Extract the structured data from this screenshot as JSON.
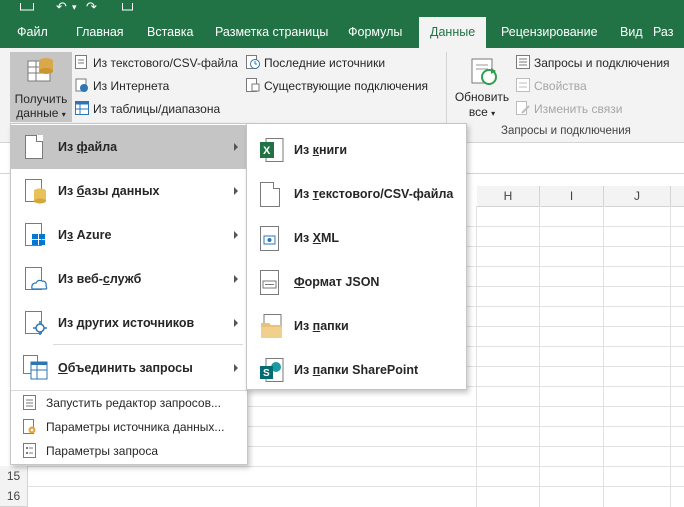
{
  "tabs": [
    "Файл",
    "Главная",
    "Вставка",
    "Разметка страницы",
    "Формулы",
    "Данные",
    "Рецензирование",
    "Вид",
    "Раз"
  ],
  "active_tab": "Данные",
  "ribbon": {
    "get_data_label_1": "Получить",
    "get_data_label_2": "данные",
    "get_group_items": [
      "Из текстового/CSV-файла",
      "Из Интернета",
      "Из таблицы/диапазона"
    ],
    "recent_items": [
      "Последние источники",
      "Существующие подключения"
    ],
    "refresh_label_1": "Обновить",
    "refresh_label_2": "все",
    "queries_items": [
      "Запросы и подключения",
      "Свойства",
      "Изменить связи"
    ],
    "queries_group_label": "Запросы и подключения"
  },
  "menu_main": {
    "items": [
      {
        "pre": "Из ",
        "u": "ф",
        "post": "айла"
      },
      {
        "pre": "Из ",
        "u": "б",
        "post": "азы данных"
      },
      {
        "pre": "И",
        "u": "з",
        "post": " Azure"
      },
      {
        "pre": "Из веб-",
        "u": "с",
        "post": "лужб"
      },
      {
        "pre": "Из ",
        "u": "д",
        "post": "ругих источников"
      },
      {
        "pre": "",
        "u": "О",
        "post": "бъединить запросы"
      }
    ],
    "bottom_items": [
      "Запустить редактор запросов...",
      "Параметры источника данных...",
      "Параметры запроса"
    ]
  },
  "menu_sub": {
    "items": [
      {
        "pre": "Из ",
        "u": "к",
        "post": "ниги"
      },
      {
        "pre": "Из ",
        "u": "т",
        "post": "екстового/CSV-файла"
      },
      {
        "pre": "Из ",
        "u": "X",
        "post": "ML"
      },
      {
        "pre": "",
        "u": "Ф",
        "post": "ормат JSON"
      },
      {
        "pre": "Из ",
        "u": "п",
        "post": "апки"
      },
      {
        "pre": "Из ",
        "u": "п",
        "post": "апки SharePoint"
      }
    ]
  },
  "sheet": {
    "columns": [
      "H",
      "I",
      "J"
    ],
    "rows": [
      "15",
      "16"
    ]
  },
  "colors": {
    "accent": "#217346",
    "ribbon_bg": "#f3f3f3",
    "hover": "#c5c5c5"
  }
}
